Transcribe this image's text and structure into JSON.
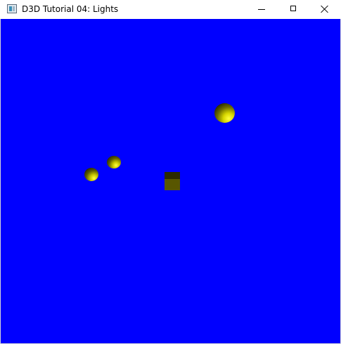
{
  "window": {
    "title": "D3D Tutorial 04: Lights",
    "icon": "application-window-icon",
    "controls": {
      "minimize": "minimize-icon",
      "maximize": "maximize-icon",
      "close": "close-icon"
    }
  },
  "scene": {
    "background_color": "#0000ff",
    "object_color": "#ffff00",
    "objects": [
      {
        "kind": "sphere",
        "name": "lit-sphere-large"
      },
      {
        "kind": "sphere",
        "name": "lit-sphere-mid"
      },
      {
        "kind": "sphere",
        "name": "lit-sphere-small"
      },
      {
        "kind": "cube",
        "name": "lit-cube"
      }
    ]
  }
}
